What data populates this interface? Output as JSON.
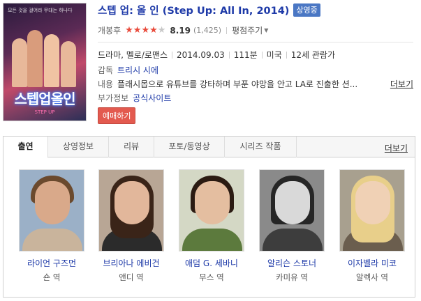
{
  "poster": {
    "tagline": "모든 것을 걸어라 무대는 하나다",
    "title": "스텝업올인"
  },
  "movie": {
    "title": "스텝 업: 올 인 (Step Up: All In, 2014)",
    "status_badge": "상영중",
    "rating_label": "개봉후",
    "stars_filled": 4,
    "stars_total": 5,
    "score": "8.19",
    "rating_count": "(1,425)",
    "rate_link": "평점주기",
    "genre": "드라마, 멜로/로맨스",
    "release_date": "2014.09.03",
    "runtime": "111분",
    "country": "미국",
    "age_rating": "12세 관람가",
    "director_label": "감독",
    "director": "트리시 시에",
    "synopsis_label": "내용",
    "synopsis": "플래시몹으로 유튜브를 강타하며 부푼 야망을 안고 LA로 진출한 션...",
    "synopsis_more": "더보기",
    "extra_label": "부가정보",
    "official_site": "공식사이트",
    "book_button": "예매하기"
  },
  "tabs": {
    "items": [
      {
        "label": "출연",
        "active": true
      },
      {
        "label": "상영정보",
        "active": false
      },
      {
        "label": "리뷰",
        "active": false
      },
      {
        "label": "포토/동영상",
        "active": false
      },
      {
        "label": "시리즈 작품",
        "active": false
      }
    ],
    "more": "더보기"
  },
  "cast": [
    {
      "name": "라이언 구즈먼",
      "role": "숀 역",
      "skin": "#d9a98a",
      "hair": "#6b4a2e",
      "bg": "#9bb0c7",
      "shirt": "#c9b49c"
    },
    {
      "name": "브리아나 에비건",
      "role": "앤디 역",
      "skin": "#e2b79b",
      "hair": "#3a2418",
      "bg": "#b8a695",
      "shirt": "#2b2b2b"
    },
    {
      "name": "애덤 G. 세바니",
      "role": "무스 역",
      "skin": "#e4bea0",
      "hair": "#2b1b12",
      "bg": "#d4d8c5",
      "shirt": "#5c7a3d"
    },
    {
      "name": "알리슨 스토너",
      "role": "카미유 역",
      "skin": "#d9d9d9",
      "hair": "#262626",
      "bg": "#8a8a8a",
      "shirt": "#3d3d3d"
    },
    {
      "name": "이자벨라 미코",
      "role": "알렉사 역",
      "skin": "#f0d1b5",
      "hair": "#e8cf8a",
      "bg": "#a8a08f",
      "shirt": "#6b5e4e"
    }
  ]
}
